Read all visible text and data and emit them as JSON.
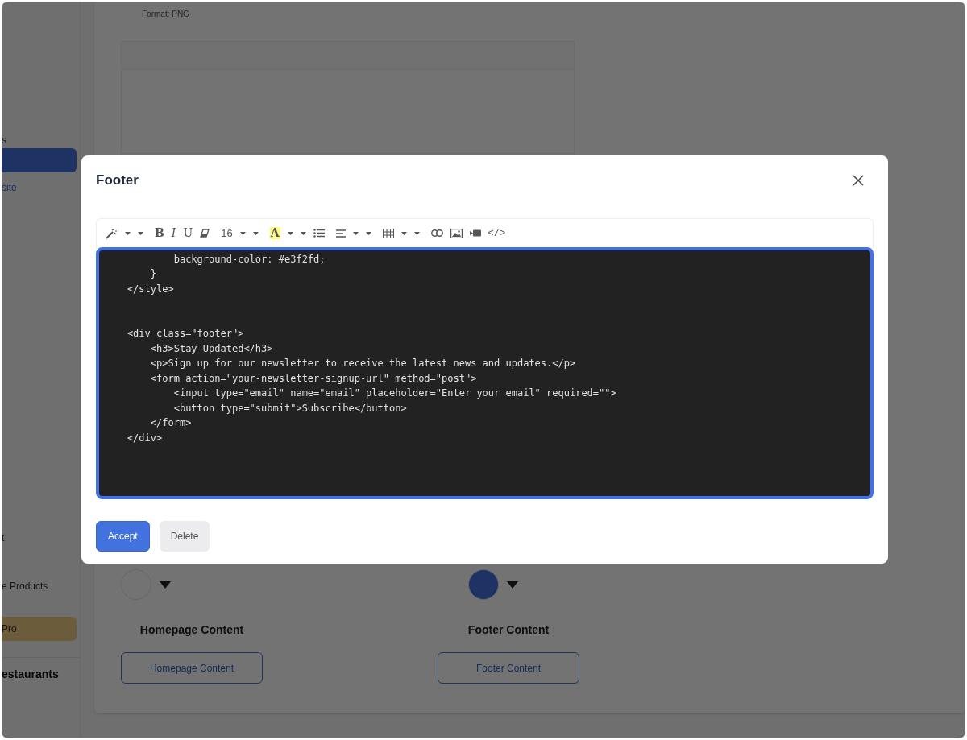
{
  "sidebar": {
    "items": [
      {
        "label": "s",
        "selected": false,
        "kind": "plain"
      },
      {
        "selected": true,
        "kind": "plain"
      },
      {
        "label": "site",
        "selected": false,
        "kind": "link"
      },
      {
        "label": "t",
        "selected": false,
        "kind": "plain"
      },
      {
        "label": "e Products",
        "selected": false,
        "kind": "plain"
      },
      {
        "label": "Pro",
        "selected": false,
        "kind": "promo"
      },
      {
        "label": "estaurants",
        "selected": false,
        "kind": "heading"
      }
    ]
  },
  "main": {
    "format_text": "Format: PNG",
    "sections": [
      {
        "color": "#737373",
        "label": "Homepage Content",
        "button": "Homepage Content"
      },
      {
        "color": "#1e3363",
        "label": "Footer Content",
        "button": "Footer Content"
      }
    ]
  },
  "modal": {
    "title": "Footer",
    "toolbar": {
      "groups": [
        [
          {
            "kind": "wand"
          },
          {
            "kind": "caret"
          },
          {
            "kind": "caret"
          }
        ],
        [
          {
            "kind": "bold",
            "label": "B"
          },
          {
            "kind": "italic",
            "label": "I"
          },
          {
            "kind": "underline",
            "label": "U"
          },
          {
            "kind": "eraser"
          }
        ],
        [
          {
            "kind": "fontsize",
            "label": "16"
          },
          {
            "kind": "caret"
          },
          {
            "kind": "caret"
          }
        ],
        [
          {
            "kind": "highlight",
            "label": "A"
          },
          {
            "kind": "caret"
          },
          {
            "kind": "caret"
          },
          {
            "kind": "list"
          }
        ],
        [
          {
            "kind": "align"
          },
          {
            "kind": "caret"
          },
          {
            "kind": "caret"
          }
        ],
        [
          {
            "kind": "table"
          },
          {
            "kind": "caret"
          },
          {
            "kind": "caret"
          }
        ],
        [
          {
            "kind": "link"
          },
          {
            "kind": "image"
          },
          {
            "kind": "video"
          },
          {
            "kind": "codeview",
            "label": "</>"
          }
        ]
      ]
    },
    "code": "            background-color: #e3f2fd;\n        }\n    </style>\n\n\n    <div class=\"footer\">\n        <h3>Stay Updated</h3>\n        <p>Sign up for our newsletter to receive the latest news and updates.</p>\n        <form action=\"your-newsletter-signup-url\" method=\"post\">\n            <input type=\"email\" name=\"email\" placeholder=\"Enter your email\" required=\"\">\n            <button type=\"submit\">Subscribe</button>\n        </form>\n    </div>",
    "buttons": [
      {
        "label": "Accept",
        "kind": "primary"
      },
      {
        "label": "Delete",
        "kind": "secondary"
      }
    ]
  }
}
